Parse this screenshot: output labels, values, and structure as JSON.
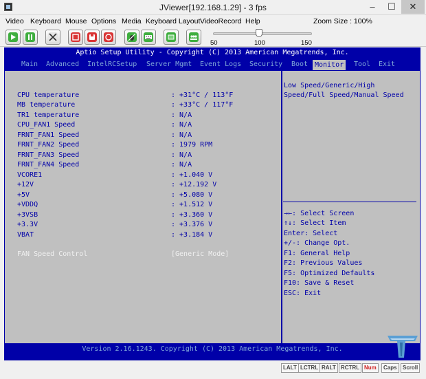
{
  "window": {
    "title": "JViewer[192.168.1.29] - 3 fps",
    "controls": [
      "–",
      "☐",
      "✕"
    ]
  },
  "menu": {
    "items": [
      "Video",
      "Keyboard",
      "Mouse",
      "Options",
      "Media",
      "Keyboard Layout",
      "VideoRecord",
      "Help"
    ],
    "zoom_label": "Zoom Size : 100%"
  },
  "toolbar": {
    "buttons": [
      {
        "name": "play-icon",
        "color": "#3fae3f"
      },
      {
        "name": "pause-icon",
        "color": "#3fae3f"
      },
      {
        "name": "fullscreen-icon",
        "color": "#e6e6e6"
      },
      {
        "name": "stop-icon",
        "color": "#d93535"
      },
      {
        "name": "record-icon",
        "color": "#d93535"
      },
      {
        "name": "capture-icon",
        "color": "#d93535"
      },
      {
        "name": "mouse-sync-icon",
        "color": "#3fae3f"
      },
      {
        "name": "keyboard-icon",
        "color": "#3fae3f"
      },
      {
        "name": "media-icon",
        "color": "#3fae3f"
      },
      {
        "name": "user-list-icon",
        "color": "#3fae3f"
      }
    ],
    "zoom_ticks": [
      "50",
      "100",
      "150"
    ],
    "zoom_value": 100
  },
  "bios": {
    "header": "Aptio Setup Utility - Copyright (C) 2013 American Megatrends, Inc.",
    "tabs": [
      "Main",
      "Advanced",
      "IntelRCSetup",
      "Server Mgmt",
      "Event Logs",
      "Security",
      "Boot",
      "Monitor",
      "Tool",
      "Exit"
    ],
    "active_tab": "Monitor",
    "rows": [
      {
        "label": "CPU temperature",
        "value": ": +31°C / 113°F"
      },
      {
        "label": "MB temperature",
        "value": ": +33°C / 117°F"
      },
      {
        "label": "TR1 temperature",
        "value": ": N/A"
      },
      {
        "label": "CPU_FAN1 Speed",
        "value": ": N/A"
      },
      {
        "label": "FRNT_FAN1 Speed",
        "value": ": N/A"
      },
      {
        "label": "FRNT_FAN2 Speed",
        "value": ": 1979 RPM"
      },
      {
        "label": "FRNT_FAN3 Speed",
        "value": ": N/A"
      },
      {
        "label": "FRNT_FAN4 Speed",
        "value": ": N/A"
      },
      {
        "label": "VCORE1",
        "value": ": +1.040 V"
      },
      {
        "label": "+12V",
        "value": ": +12.192 V"
      },
      {
        "label": "+5V",
        "value": ": +5.080 V"
      },
      {
        "label": "+VDDQ",
        "value": ": +1.512 V"
      },
      {
        "label": "+3VSB",
        "value": ": +3.360 V"
      },
      {
        "label": "+3.3V",
        "value": ": +3.376 V"
      },
      {
        "label": "VBAT",
        "value": ": +3.184 V"
      }
    ],
    "fan_control": {
      "label": "FAN Speed Control",
      "value": "[Generic Mode]"
    },
    "help": [
      "Low Speed/Generic/High",
      "Speed/Full Speed/Manual Speed"
    ],
    "keys": [
      "→←: Select Screen",
      "↑↓: Select Item",
      "Enter: Select",
      "+/-: Change Opt.",
      "F1: General Help",
      "F2: Previous Values",
      "F5: Optimized Defaults",
      "F10: Save & Reset",
      "ESC: Exit"
    ],
    "footer": "Version 2.16.1243. Copyright (C) 2013 American Megatrends, Inc."
  },
  "status": {
    "lock_keys": [
      {
        "label": "LALT",
        "on": false
      },
      {
        "label": "LCTRL",
        "on": false
      },
      {
        "label": "RALT",
        "on": false
      },
      {
        "label": "RCTRL",
        "on": false
      },
      {
        "label": "Num",
        "on": true
      },
      {
        "label": "Caps",
        "on": false
      },
      {
        "label": "Scroll",
        "on": false
      }
    ]
  },
  "logo": {
    "name": "tweaktown-logo",
    "color": "#5a9fd4"
  }
}
